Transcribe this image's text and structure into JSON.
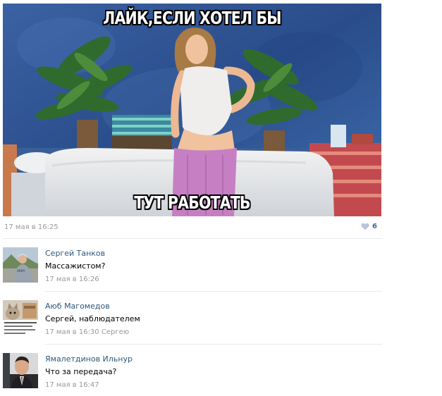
{
  "post": {
    "meme_top": "ЛАЙК,ЕСЛИ ХОТЕЛ БЫ",
    "meme_bottom": "ТУТ РАБОТАТЬ",
    "date": "17 мая в 16:25",
    "likes": "6"
  },
  "comments": [
    {
      "author": "Сергей Танков",
      "text": "Массажистом?",
      "time": "17 мая в 16:26",
      "reply_to": ""
    },
    {
      "author": "Аюб Магомедов",
      "text": "Сергей, наблюдателем",
      "time": "17 мая в 16:30",
      "reply_to": "Сергею"
    },
    {
      "author": "Ямалетдинов Ильнур",
      "text": "Что за передача?",
      "time": "17 мая в 16:47",
      "reply_to": ""
    }
  ],
  "colors": {
    "link": "#2b587a",
    "meta": "#999999",
    "like": "#45688e",
    "separator": "#e7eaed"
  },
  "icons": {
    "like": "heart-icon"
  }
}
